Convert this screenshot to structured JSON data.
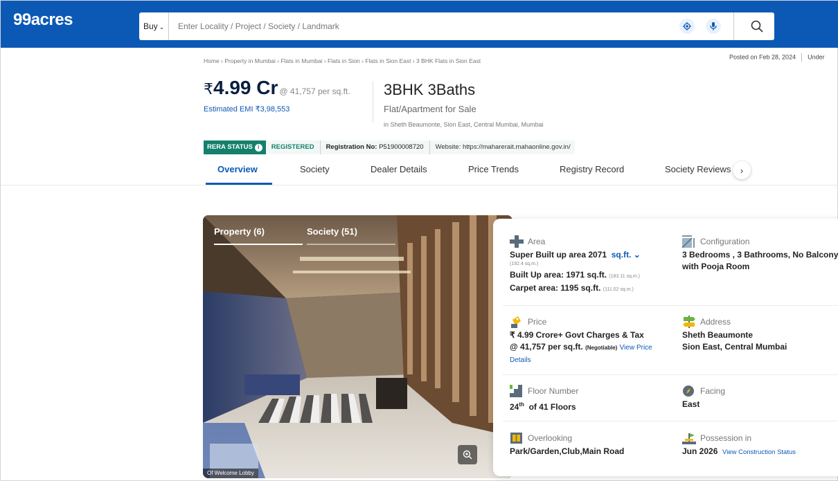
{
  "header": {
    "logo": "99acres",
    "buy_label": "Buy",
    "search_placeholder": "Enter Locality / Project / Society / Landmark"
  },
  "breadcrumb": "Home › Property in Mumbai › Flats in Mumbai › Flats in Sion › Flats in Sion East › 3 BHK Flats in Sion East",
  "posted": {
    "date": "Posted on Feb 28, 2024",
    "status": "Under"
  },
  "price": {
    "symbol": "₹",
    "amount": "4.99 Cr",
    "per_sqft": "@ 41,757 per sq.ft.",
    "emi": "Estimated EMI ₹3,98,553"
  },
  "listing": {
    "title": "3BHK 3Baths",
    "type": "Flat/Apartment for Sale",
    "location": "in Sheth Beaumonte, Sion East, Central Mumbai, Mumbai"
  },
  "rera": {
    "badge": "RERA STATUS",
    "status": "REGISTERED",
    "reg_label": "Registration No:",
    "reg_no": "P51900008720",
    "website": "Website: https://maharerait.mahaonline.gov.in/"
  },
  "tabs": [
    {
      "label": "Overview",
      "active": true
    },
    {
      "label": "Society"
    },
    {
      "label": "Dealer Details"
    },
    {
      "label": "Price Trends"
    },
    {
      "label": "Registry Record"
    },
    {
      "label": "Society Reviews"
    }
  ],
  "photo": {
    "tab_property": "Property (6)",
    "tab_society": "Society (51)",
    "caption": "Of Welcome Lobby"
  },
  "details": {
    "area": {
      "label": "Area",
      "super_built_up": "Super Built up area 2071",
      "unit": "sq.ft.",
      "super_sqm": "(192.4 sq.m.)",
      "built_up": "Built Up area: 1971 sq.ft.",
      "built_up_sqm": "(183.11 sq.m.)",
      "carpet": "Carpet area: 1195 sq.ft.",
      "carpet_sqm": "(111.02 sq.m.)"
    },
    "configuration": {
      "label": "Configuration",
      "line1": "3 Bedrooms , 3 Bathrooms, No Balcony",
      "line2": "with Pooja Room"
    },
    "price": {
      "label": "Price",
      "line1": "₹ 4.99 Crore+ Govt Charges & Tax",
      "line2": "@ 41,757 per sq.ft.",
      "negotiable": "(Negotiable)",
      "link1": "View Price",
      "link2": "Details"
    },
    "address": {
      "label": "Address",
      "line1": "Sheth Beaumonte",
      "line2": "Sion East, Central Mumbai"
    },
    "floor": {
      "label": "Floor Number",
      "floor": "24",
      "suffix": "th",
      "of": "of 41 Floors"
    },
    "facing": {
      "label": "Facing",
      "value": "East"
    },
    "overlooking": {
      "label": "Overlooking",
      "value": "Park/Garden,Club,Main Road"
    },
    "possession": {
      "label": "Possession in",
      "value": "Jun 2026",
      "link": "View Construction Status"
    }
  },
  "colors": {
    "brand": "#0B59B5",
    "rera_green": "#13806B"
  }
}
